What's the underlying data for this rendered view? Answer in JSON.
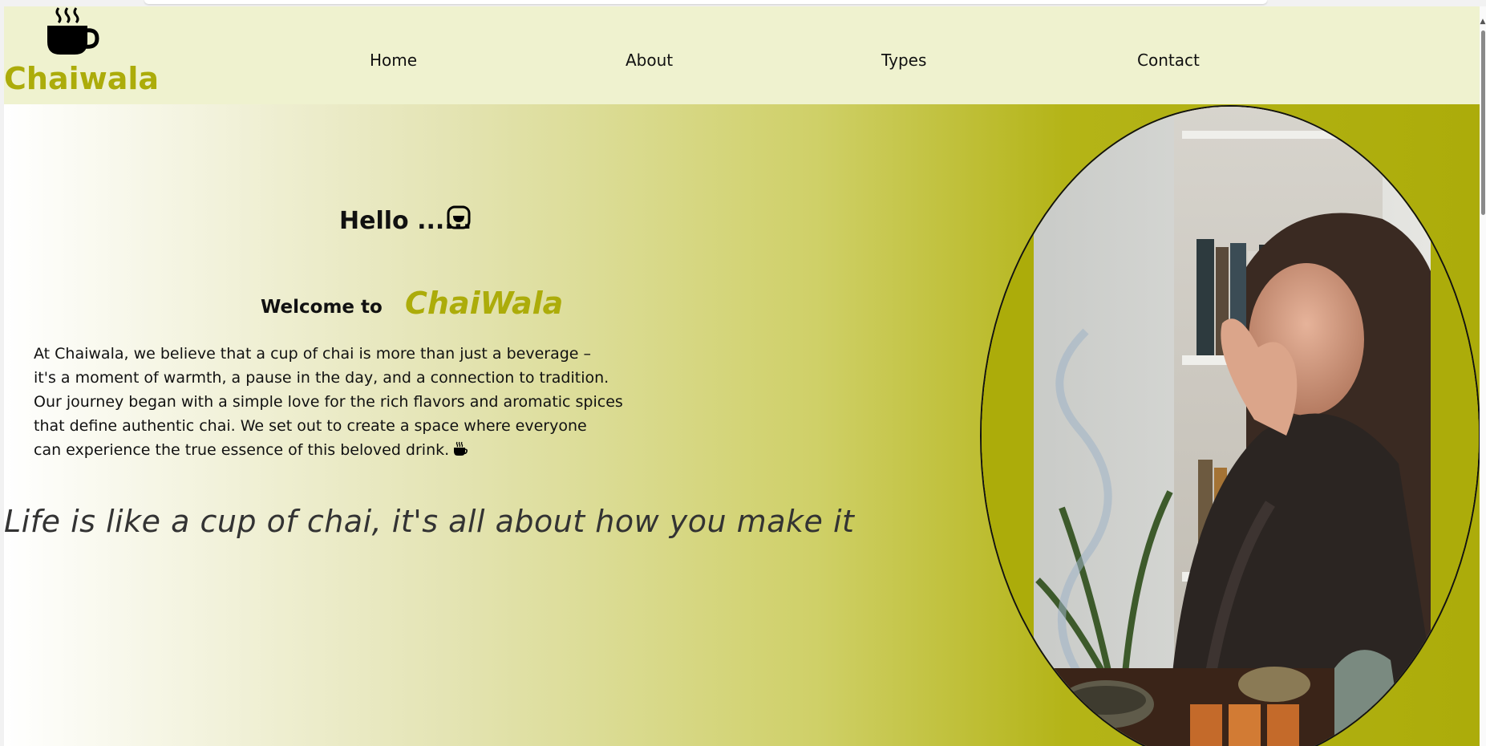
{
  "header": {
    "logo_icon": "steaming-cup-icon",
    "brand_name": "Chaiwala",
    "nav": [
      {
        "label": "Home"
      },
      {
        "label": "About"
      },
      {
        "label": "Types"
      },
      {
        "label": "Contact"
      }
    ]
  },
  "hero": {
    "greeting": "Hello ......",
    "greeting_icon": "smiling-face-icon",
    "welcome_prefix": "Welcome to",
    "welcome_brand": "ChaiWala",
    "paragraph_lines": [
      "At Chaiwala, we believe that a cup of chai is more than just a beverage –",
      "it's a moment of warmth, a pause in the day, and a connection to tradition.",
      "Our journey began with a simple love for the rich flavors and aromatic spices",
      "that define authentic chai. We set out to create a space where everyone",
      "can experience the true essence of this beloved drink."
    ],
    "paragraph_icon": "coffee-cup-icon",
    "quote": "Life is like a cup of chai, it's all about how you make it",
    "image_subject": "woman-sipping-tea-photo"
  },
  "colors": {
    "brand": "#acac0a",
    "navbar_bg": "#eff2cf",
    "text": "#111111"
  }
}
